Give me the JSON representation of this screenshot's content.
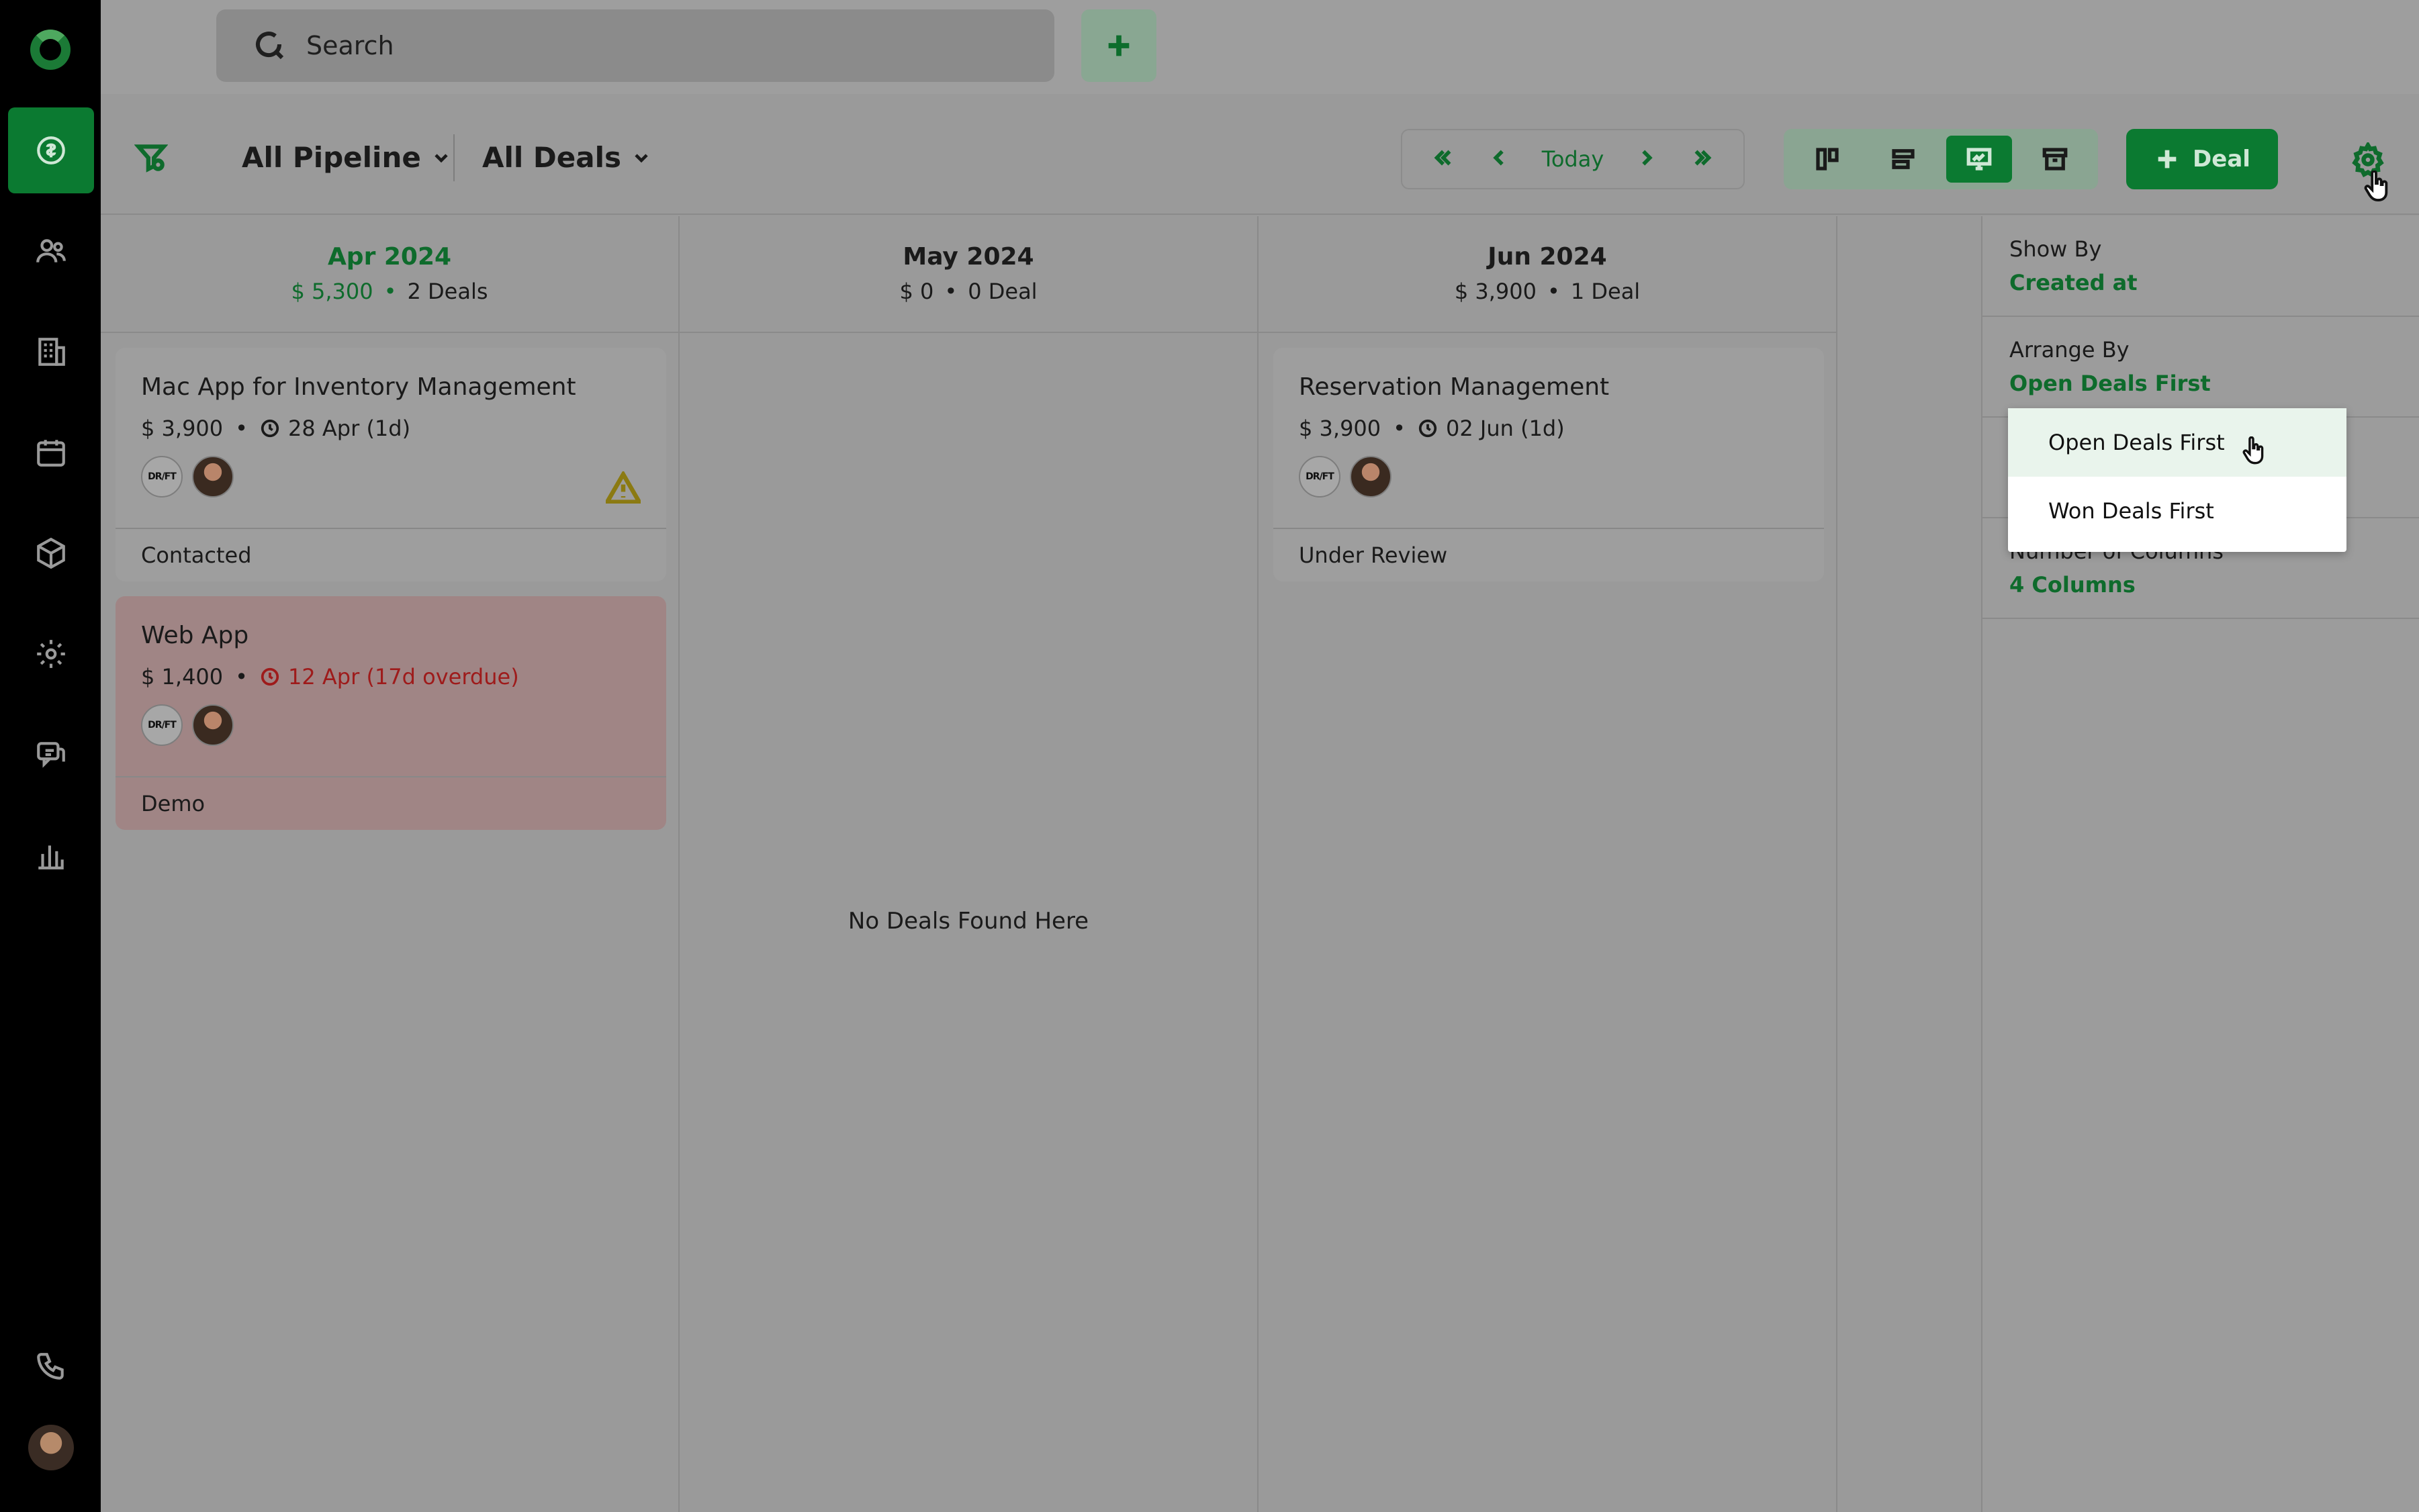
{
  "search": {
    "placeholder": "Search"
  },
  "toolbar": {
    "pipeline_label": "All Pipeline",
    "deals_label": "All Deals",
    "today_label": "Today",
    "deal_button_label": "Deal"
  },
  "columns": [
    {
      "title": "Apr 2024",
      "amount": "$ 5,300",
      "count": "2 Deals",
      "cards": [
        {
          "title": "Mac App for Inventory Management",
          "amount": "$ 3,900",
          "due": "28 Apr (1d)",
          "stage": "Contacted",
          "brand": "DR/FT"
        },
        {
          "title": "Web App",
          "amount": "$ 1,400",
          "due": "12 Apr (17d overdue)",
          "stage": "Demo",
          "brand": "DR/FT"
        }
      ]
    },
    {
      "title": "May 2024",
      "amount": "$ 0",
      "count": "0 Deal",
      "empty_text": "No Deals Found Here"
    },
    {
      "title": "Jun 2024",
      "amount": "$ 3,900",
      "count": "1 Deal",
      "cards": [
        {
          "title": "Reservation Management",
          "amount": "$ 3,900",
          "due": "02 Jun (1d)",
          "stage": "Under Review",
          "brand": "DR/FT"
        }
      ]
    }
  ],
  "settings": {
    "show_by_label": "Show By",
    "show_by_value": "Created at",
    "arrange_by_label": "Arrange By",
    "arrange_by_value": "Open Deals First",
    "columns_label": "Number of Columns",
    "columns_value": "4 Columns"
  },
  "arrange_dropdown": {
    "options": [
      "Open Deals First",
      "Won Deals First"
    ],
    "selected": "Open Deals First"
  },
  "colors": {
    "accent": "#0b7a31",
    "overdue": "#9e1b1b"
  }
}
